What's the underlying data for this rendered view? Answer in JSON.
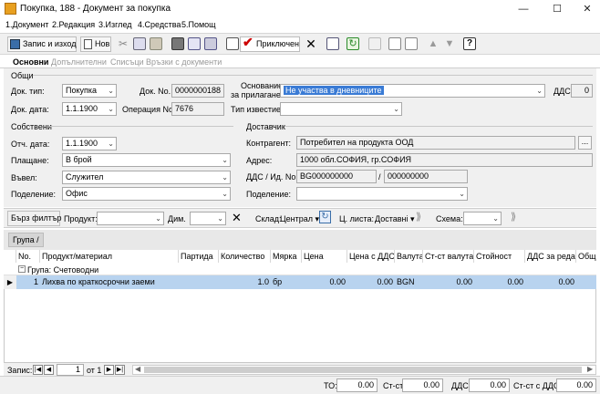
{
  "window": {
    "title": "Покупка, 188 - Документ за покупка",
    "minimize": "—",
    "maximize": "☐",
    "close": "✕"
  },
  "menu": [
    "1.Документ",
    "2.Редакция",
    "3.Изглед",
    "4.Средства",
    "5.Помощ"
  ],
  "toolbar": {
    "save_exit": "Запис и изход",
    "new": "Нов",
    "posted": "Приключен",
    "icons": [
      "save-icon",
      "new-icon",
      "cut-icon",
      "copy-icon",
      "paste-icon",
      "print-icon",
      "preview-icon",
      "attach-icon",
      "edit-icon",
      "check-icon",
      "close-icon",
      "calendar-icon",
      "refresh-icon",
      "empty-icon",
      "page-icon",
      "page2-icon",
      "up-icon",
      "down-icon",
      "help-icon"
    ]
  },
  "tabs": [
    "Основни",
    "Допълнителни",
    "Списъци",
    "Връзки с документи"
  ],
  "general": {
    "section": "Общи",
    "doc_type_label": "Док. тип:",
    "doc_type": "Покупка",
    "doc_no_label": "Док. No.",
    "doc_no": "0000000188",
    "basis_label_1": "Основание",
    "basis_label_2": "за прилагане:",
    "basis": "Не участва в дневниците",
    "vat_label": "ДДС:",
    "vat": "0",
    "doc_date_label": "Док. дата:",
    "doc_date": "1.1.1900",
    "op_no_label": "Операция No.",
    "op_no": "7676",
    "notice_label": "Тип известие:",
    "notice": ""
  },
  "own": {
    "section": "Собствени",
    "acc_date_label": "Отч. дата:",
    "acc_date": "1.1.1900",
    "payment_label": "Плащане:",
    "payment": "В брой",
    "entered_label": "Въвел:",
    "entered": "Служител",
    "division_label": "Поделение:",
    "division": "Офис"
  },
  "supplier": {
    "section": "Доставчик",
    "contractor_label": "Контрагент:",
    "contractor": "Потребител на продукта ООД",
    "address_label": "Адрес:",
    "address": "1000 обл.СОФИЯ, гр.СОФИЯ",
    "vat_id_label": "ДДС / Ид. No.",
    "vat_no": "BG000000000",
    "id_no": "000000000",
    "division_label": "Поделение:",
    "division": ""
  },
  "filter": {
    "quick_filter": "Бърз филтър",
    "product_label": "Продукт:",
    "dim_label": "Дим.",
    "warehouse_label": "Склад:",
    "warehouse": "Централ",
    "price_list_label": "Ц. листа:",
    "price_list": "Доставні",
    "scheme_label": "Схема:"
  },
  "group_chip": "Група",
  "grid": {
    "columns": [
      "No.",
      "Продукт/материал",
      "Партида",
      "Количество",
      "Мярка",
      "Цена",
      "Цена с ДДС",
      "Валута",
      "Ст-ст валута",
      "Стойност",
      "ДДС за реда",
      "Общо"
    ],
    "group_row": "Група: Счетоводни",
    "rows": [
      {
        "no": "1",
        "product": "Лихва по краткосрочни заеми",
        "batch": "",
        "qty": "1.0",
        "unit": "бр",
        "price": "0.00",
        "price_vat": "0.00",
        "currency": "BGN",
        "value_cur": "0.00",
        "value": "0.00",
        "vat": "0.00",
        "total": ""
      }
    ]
  },
  "nav": {
    "label": "Запис:",
    "current": "1",
    "of": "от 1"
  },
  "totals": {
    "to_label": "ТО:",
    "to": "0.00",
    "value_label": "Ст-ст:",
    "value": "0.00",
    "vat_label": "ДДС:",
    "vat": "0.00",
    "value_vat_label": "Ст-ст с ДДС:",
    "value_vat": "0.00"
  }
}
